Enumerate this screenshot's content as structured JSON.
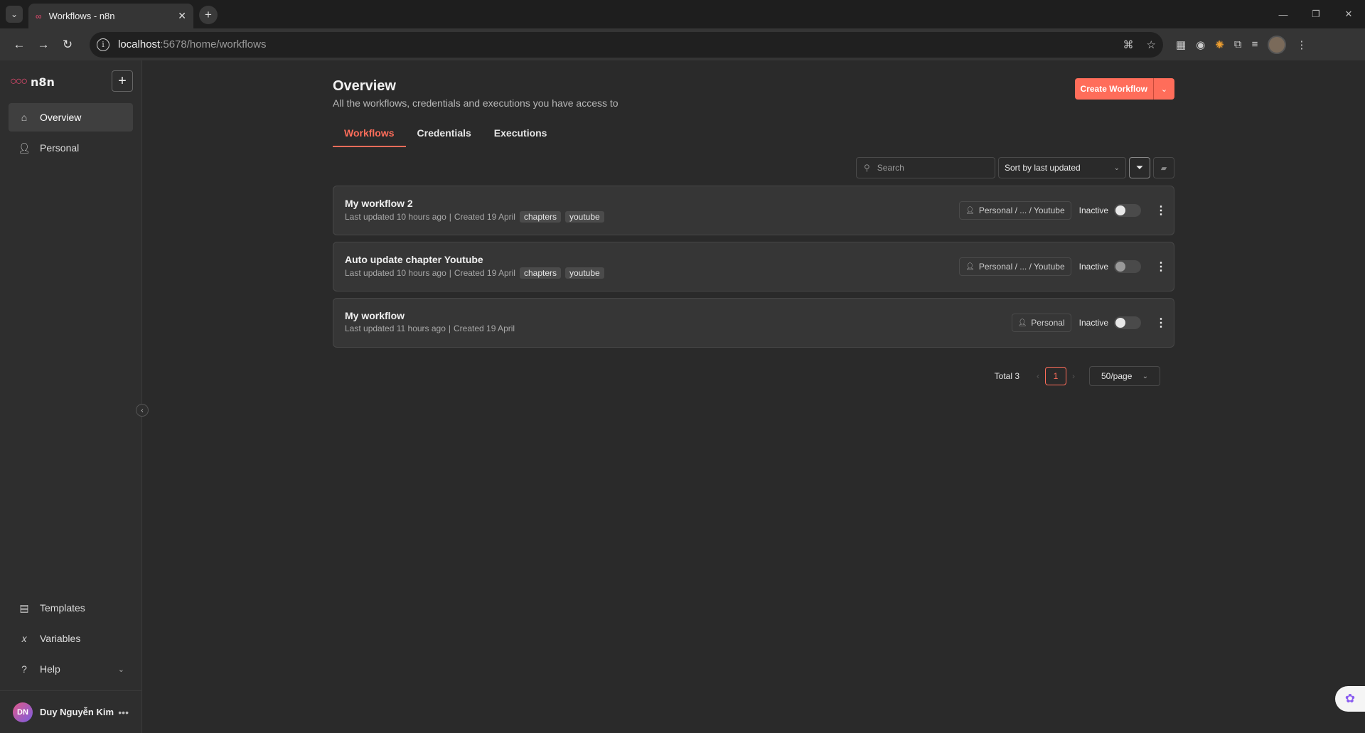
{
  "browser": {
    "tab_title": "Workflows - n8n",
    "url_host": "localhost",
    "url_path": ":5678/home/workflows"
  },
  "sidebar": {
    "brand": "n8n",
    "items": [
      {
        "label": "Overview",
        "icon": "home-icon"
      },
      {
        "label": "Personal",
        "icon": "user-icon"
      }
    ],
    "bottom_items": [
      {
        "label": "Templates",
        "icon": "box-icon"
      },
      {
        "label": "Variables",
        "icon": "variable-icon"
      },
      {
        "label": "Help",
        "icon": "question-icon"
      }
    ],
    "user": {
      "initials": "DN",
      "name": "Duy Nguyễn Kim"
    }
  },
  "header": {
    "title": "Overview",
    "subtitle": "All the workflows, credentials and executions you have access to",
    "create_label": "Create Workflow"
  },
  "tabs": [
    {
      "label": "Workflows",
      "active": true
    },
    {
      "label": "Credentials",
      "active": false
    },
    {
      "label": "Executions",
      "active": false
    }
  ],
  "filters": {
    "search_placeholder": "Search",
    "sort_value": "Sort by last updated"
  },
  "workflows": [
    {
      "name": "My workflow 2",
      "updated": "Last updated 10 hours ago",
      "created": "Created 19 April",
      "tags": [
        "chapters",
        "youtube"
      ],
      "owner": "Personal / ... / Youtube",
      "status": "Inactive"
    },
    {
      "name": "Auto update chapter Youtube",
      "updated": "Last updated 10 hours ago",
      "created": "Created 19 April",
      "tags": [
        "chapters",
        "youtube"
      ],
      "owner": "Personal / ... / Youtube",
      "status": "Inactive"
    },
    {
      "name": "My workflow",
      "updated": "Last updated 11 hours ago",
      "created": "Created 19 April",
      "tags": [],
      "owner": "Personal",
      "status": "Inactive"
    }
  ],
  "pagination": {
    "total": "Total 3",
    "current_page": "1",
    "page_size": "50/page"
  },
  "colors": {
    "accent": "#ff6d5a",
    "brand": "#ea4b71",
    "background": "#2a2a2a",
    "sidebar": "#2e2e2e",
    "card": "#363636"
  }
}
